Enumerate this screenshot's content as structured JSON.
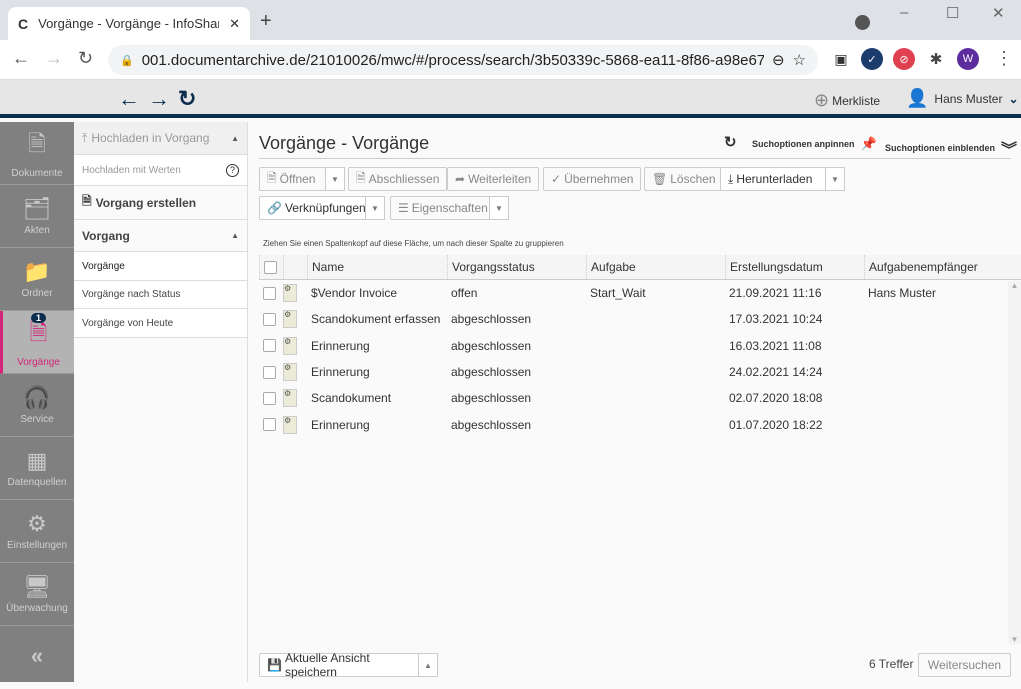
{
  "browser": {
    "tab_title": "Vorgänge - Vorgänge - InfoShare",
    "tab_favicon": "C",
    "url": "001.documentarchive.de/21010026/mwc/#/process/search/3b50339c-5868-ea11-8f86-a98e67e5...",
    "profile_initial": "W"
  },
  "header": {
    "merkliste": "Merkliste",
    "user": "Hans Muster"
  },
  "sidebar": {
    "items": [
      {
        "label": "Dokumente",
        "icon": "document-icon"
      },
      {
        "label": "Akten",
        "icon": "file-folder-icon"
      },
      {
        "label": "Ordner",
        "icon": "folder-icon"
      },
      {
        "label": "Vorgänge",
        "icon": "process-icon",
        "badge": "1",
        "active": true
      },
      {
        "label": "Service",
        "icon": "headset-icon"
      },
      {
        "label": "Datenquellen",
        "icon": "table-icon"
      },
      {
        "label": "Einstellungen",
        "icon": "gears-icon"
      },
      {
        "label": "Überwachung",
        "icon": "monitor-icon"
      }
    ]
  },
  "panel": {
    "upload": "Hochladen in Vorgang",
    "upload_values": "Hochladen mit Werten",
    "create": "Vorgang erstellen",
    "section": "Vorgang",
    "items": [
      "Vorgänge",
      "Vorgänge nach Status",
      "Vorgänge von Heute"
    ]
  },
  "main": {
    "title": "Vorgänge - Vorgänge",
    "pin": "Suchoptionen anpinnen",
    "show": "Suchoptionen einblenden",
    "toolbar": {
      "open": "Öffnen",
      "close": "Abschliessen",
      "forward": "Weiterleiten",
      "take": "Übernehmen",
      "delete": "Löschen",
      "download": "Herunterladen",
      "links": "Verknüpfungen",
      "props": "Eigenschaften"
    },
    "group_hint": "Ziehen Sie einen Spaltenkopf auf diese Fläche, um nach dieser Spalte zu gruppieren",
    "columns": [
      "Name",
      "Vorgangsstatus",
      "Aufgabe",
      "Erstellungsdatum",
      "Aufgabenempfänger"
    ],
    "rows": [
      [
        "$Vendor Invoice",
        "offen",
        "Start_Wait",
        "21.09.2021 11:16",
        "Hans Muster"
      ],
      [
        "Scandokument erfassen",
        "abgeschlossen",
        "",
        "17.03.2021 10:24",
        ""
      ],
      [
        "Erinnerung",
        "abgeschlossen",
        "",
        "16.03.2021 11:08",
        ""
      ],
      [
        "Erinnerung",
        "abgeschlossen",
        "",
        "24.02.2021 14:24",
        ""
      ],
      [
        "Scandokument",
        "abgeschlossen",
        "",
        "02.07.2020 18:08",
        ""
      ],
      [
        "Erinnerung",
        "abgeschlossen",
        "",
        "01.07.2020 18:22",
        ""
      ]
    ],
    "save_view": "Aktuelle Ansicht speichern",
    "hits": "6 Treffer",
    "more": "Weitersuchen"
  },
  "colors": {
    "accent": "#d4237a",
    "navy": "#0b2e4f",
    "sidebar": "#808080"
  }
}
